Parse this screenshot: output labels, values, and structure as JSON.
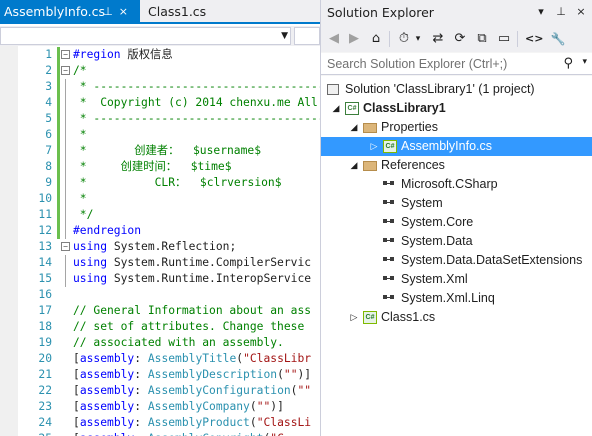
{
  "editor": {
    "tabs": [
      {
        "label": "AssemblyInfo.cs",
        "pin_icon": "⊥",
        "close_icon": "×",
        "active": true
      },
      {
        "label": "Class1.cs",
        "active": false
      }
    ],
    "navigation_combo_value": "",
    "code_lines": [
      {
        "n": "1",
        "segs": [
          {
            "c": "kw",
            "t": "#region "
          },
          {
            "c": "pln",
            "t": "版权信息"
          }
        ]
      },
      {
        "n": "2",
        "segs": [
          {
            "c": "cmt",
            "t": "/*"
          }
        ]
      },
      {
        "n": "3",
        "segs": [
          {
            "c": "cmt",
            "t": " * ---------------------------------------------"
          }
        ]
      },
      {
        "n": "4",
        "segs": [
          {
            "c": "cmt",
            "t": " *  Copyright (c) 2014 chenxu.me All"
          }
        ]
      },
      {
        "n": "5",
        "segs": [
          {
            "c": "cmt",
            "t": " * ---------------------------------------------"
          }
        ]
      },
      {
        "n": "6",
        "segs": [
          {
            "c": "cmt",
            "t": " *"
          }
        ]
      },
      {
        "n": "7",
        "segs": [
          {
            "c": "cmt",
            "t": " *       创建者：  $username$"
          }
        ]
      },
      {
        "n": "8",
        "segs": [
          {
            "c": "cmt",
            "t": " *     创建时间：  $time$"
          }
        ]
      },
      {
        "n": "9",
        "segs": [
          {
            "c": "cmt",
            "t": " *          CLR：  $clrversion$"
          }
        ]
      },
      {
        "n": "10",
        "segs": [
          {
            "c": "cmt",
            "t": " *"
          }
        ]
      },
      {
        "n": "11",
        "segs": [
          {
            "c": "cmt",
            "t": " */"
          }
        ]
      },
      {
        "n": "12",
        "segs": [
          {
            "c": "kw",
            "t": "#endregion"
          }
        ]
      },
      {
        "n": "13",
        "segs": [
          {
            "c": "kw",
            "t": "using"
          },
          {
            "c": "pln",
            "t": " System.Reflection;"
          }
        ]
      },
      {
        "n": "14",
        "segs": [
          {
            "c": "kw",
            "t": "using"
          },
          {
            "c": "pln",
            "t": " System.Runtime.CompilerServic"
          }
        ]
      },
      {
        "n": "15",
        "segs": [
          {
            "c": "kw",
            "t": "using"
          },
          {
            "c": "pln",
            "t": " System.Runtime.InteropService"
          }
        ]
      },
      {
        "n": "16",
        "segs": []
      },
      {
        "n": "17",
        "segs": [
          {
            "c": "cmt",
            "t": "// General Information about an ass"
          }
        ]
      },
      {
        "n": "18",
        "segs": [
          {
            "c": "cmt",
            "t": "// set of attributes. Change these"
          }
        ]
      },
      {
        "n": "19",
        "segs": [
          {
            "c": "cmt",
            "t": "// associated with an assembly."
          }
        ]
      },
      {
        "n": "20",
        "segs": [
          {
            "c": "pln",
            "t": "["
          },
          {
            "c": "kw",
            "t": "assembly"
          },
          {
            "c": "pln",
            "t": ": "
          },
          {
            "c": "typ",
            "t": "AssemblyTitle"
          },
          {
            "c": "pln",
            "t": "("
          },
          {
            "c": "str",
            "t": "\"ClassLibr"
          }
        ]
      },
      {
        "n": "21",
        "segs": [
          {
            "c": "pln",
            "t": "["
          },
          {
            "c": "kw",
            "t": "assembly"
          },
          {
            "c": "pln",
            "t": ": "
          },
          {
            "c": "typ",
            "t": "AssemblyDescription"
          },
          {
            "c": "pln",
            "t": "("
          },
          {
            "c": "str",
            "t": "\"\""
          },
          {
            "c": "pln",
            "t": ")]"
          }
        ]
      },
      {
        "n": "22",
        "segs": [
          {
            "c": "pln",
            "t": "["
          },
          {
            "c": "kw",
            "t": "assembly"
          },
          {
            "c": "pln",
            "t": ": "
          },
          {
            "c": "typ",
            "t": "AssemblyConfiguration"
          },
          {
            "c": "pln",
            "t": "("
          },
          {
            "c": "str",
            "t": "\"\""
          }
        ]
      },
      {
        "n": "23",
        "segs": [
          {
            "c": "pln",
            "t": "["
          },
          {
            "c": "kw",
            "t": "assembly"
          },
          {
            "c": "pln",
            "t": ": "
          },
          {
            "c": "typ",
            "t": "AssemblyCompany"
          },
          {
            "c": "pln",
            "t": "("
          },
          {
            "c": "str",
            "t": "\"\""
          },
          {
            "c": "pln",
            "t": ")]"
          }
        ]
      },
      {
        "n": "24",
        "segs": [
          {
            "c": "pln",
            "t": "["
          },
          {
            "c": "kw",
            "t": "assembly"
          },
          {
            "c": "pln",
            "t": ": "
          },
          {
            "c": "typ",
            "t": "AssemblyProduct"
          },
          {
            "c": "pln",
            "t": "("
          },
          {
            "c": "str",
            "t": "\"ClassLi"
          }
        ]
      },
      {
        "n": "25",
        "segs": [
          {
            "c": "pln",
            "t": "["
          },
          {
            "c": "kw",
            "t": "assembly"
          },
          {
            "c": "pln",
            "t": ": "
          },
          {
            "c": "typ",
            "t": "AssemblyCopyright"
          },
          {
            "c": "pln",
            "t": "("
          },
          {
            "c": "str",
            "t": "\"C"
          }
        ]
      }
    ]
  },
  "solution_explorer": {
    "title": "Solution Explorer",
    "title_buttons": {
      "dropdown": "▾",
      "pin": "⊥",
      "close": "×"
    },
    "toolbar": {
      "back": "◀",
      "forward": "▶",
      "home": "⌂",
      "history": "⏱",
      "history_drop": "▾",
      "sync": "⇄",
      "refresh": "⟳",
      "collapse": "⧉",
      "properties": "▭",
      "view_code": "<>",
      "settings": "🔧"
    },
    "search_placeholder": "Search Solution Explorer (Ctrl+;)",
    "search_icon": "⚲",
    "search_drop": "▾",
    "tree": [
      {
        "label": "Solution 'ClassLibrary1' (1 project)",
        "icon": "solution-icon",
        "depth": 0,
        "expander": "",
        "bold": false,
        "selected": false
      },
      {
        "label": "ClassLibrary1",
        "icon": "csharp-project-icon",
        "badge": "C#",
        "depth": 1,
        "expander": "◢",
        "bold": true,
        "selected": false
      },
      {
        "label": "Properties",
        "icon": "folder-icon",
        "depth": 2,
        "expander": "◢",
        "bold": false,
        "selected": false
      },
      {
        "label": "AssemblyInfo.cs",
        "icon": "csharp-file-icon",
        "badge": "C#",
        "depth": 3,
        "expander": "▷",
        "bold": false,
        "selected": true
      },
      {
        "label": "References",
        "icon": "references-icon",
        "depth": 2,
        "expander": "◢",
        "bold": false,
        "selected": false
      },
      {
        "label": "Microsoft.CSharp",
        "icon": "reference-icon",
        "depth": 3,
        "expander": "",
        "bold": false,
        "selected": false
      },
      {
        "label": "System",
        "icon": "reference-icon",
        "depth": 3,
        "expander": "",
        "bold": false,
        "selected": false
      },
      {
        "label": "System.Core",
        "icon": "reference-icon",
        "depth": 3,
        "expander": "",
        "bold": false,
        "selected": false
      },
      {
        "label": "System.Data",
        "icon": "reference-icon",
        "depth": 3,
        "expander": "",
        "bold": false,
        "selected": false
      },
      {
        "label": "System.Data.DataSetExtensions",
        "icon": "reference-icon",
        "depth": 3,
        "expander": "",
        "bold": false,
        "selected": false
      },
      {
        "label": "System.Xml",
        "icon": "reference-icon",
        "depth": 3,
        "expander": "",
        "bold": false,
        "selected": false
      },
      {
        "label": "System.Xml.Linq",
        "icon": "reference-icon",
        "depth": 3,
        "expander": "",
        "bold": false,
        "selected": false
      },
      {
        "label": "Class1.cs",
        "icon": "csharp-file-icon",
        "badge": "C#",
        "depth": 2,
        "expander": "▷",
        "bold": false,
        "selected": false
      }
    ]
  },
  "colors": {
    "accent": "#007acc",
    "selection": "#3399ff",
    "comment": "#008000",
    "keyword": "#0000ff",
    "type": "#2b91af",
    "string": "#a31515"
  }
}
